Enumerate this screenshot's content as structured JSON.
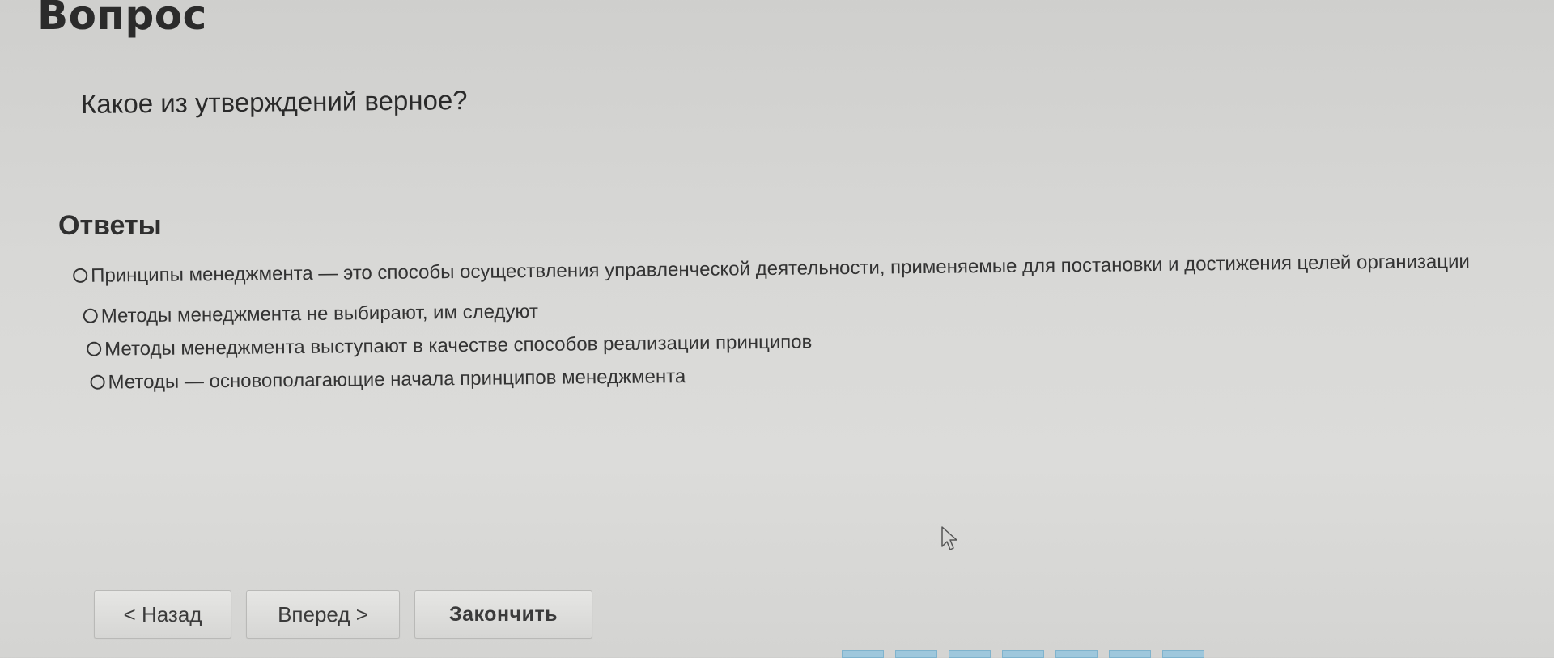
{
  "page": {
    "title": "Вопрос"
  },
  "question": {
    "text": "Какое из утверждений верное?"
  },
  "answers": {
    "title": "Ответы",
    "options": [
      "Принципы менеджмента — это способы осуществления управленческой деятельности, применяемые для постановки и достижения целей организации",
      "Методы менеджмента не выбирают, им следуют",
      "Методы менеджмента выступают в качестве способов реализации принципов",
      "Методы — основополагающие начала принципов менеджмента"
    ]
  },
  "navigation": {
    "back_label": "< Назад",
    "next_label": "Вперед >",
    "finish_label": "Закончить"
  },
  "icons": {
    "radio": "radio-circle-icon",
    "cursor": "mouse-pointer-icon"
  },
  "colors": {
    "background": "#d8d8d6",
    "text": "#2e2e2e",
    "page_marker": "#9ec7dc"
  }
}
